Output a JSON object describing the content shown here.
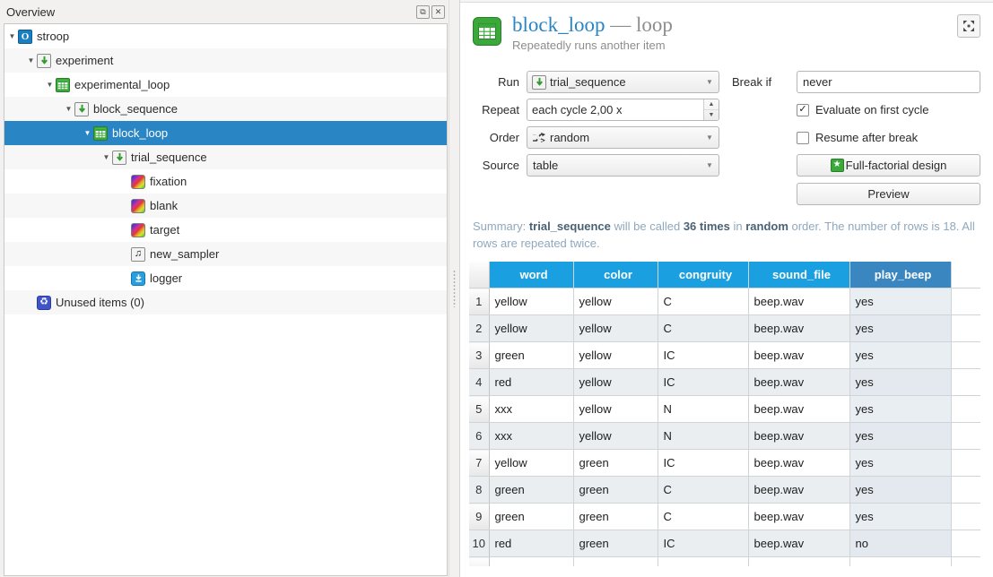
{
  "overview": {
    "title": "Overview",
    "dock_buttons": [
      {
        "name": "undock-button",
        "glyph": "⧉"
      },
      {
        "name": "close-button",
        "glyph": "✕"
      }
    ],
    "tree": [
      {
        "label": "stroop",
        "icon": "experiment-icon",
        "depth": 0,
        "expanded": true,
        "selected": false
      },
      {
        "label": "experiment",
        "icon": "sequence-icon",
        "depth": 1,
        "expanded": true,
        "selected": false
      },
      {
        "label": "experimental_loop",
        "icon": "loop-icon",
        "depth": 2,
        "expanded": true,
        "selected": false
      },
      {
        "label": "block_sequence",
        "icon": "sequence-icon",
        "depth": 3,
        "expanded": true,
        "selected": false
      },
      {
        "label": "block_loop",
        "icon": "loop-icon",
        "depth": 4,
        "expanded": true,
        "selected": true
      },
      {
        "label": "trial_sequence",
        "icon": "sequence-icon",
        "depth": 5,
        "expanded": true,
        "selected": false
      },
      {
        "label": "fixation",
        "icon": "sketchpad-icon",
        "depth": 6,
        "expanded": null,
        "selected": false
      },
      {
        "label": "blank",
        "icon": "sketchpad-icon",
        "depth": 6,
        "expanded": null,
        "selected": false
      },
      {
        "label": "target",
        "icon": "sketchpad-icon",
        "depth": 6,
        "expanded": null,
        "selected": false
      },
      {
        "label": "new_sampler",
        "icon": "sampler-icon",
        "depth": 6,
        "expanded": null,
        "selected": false
      },
      {
        "label": "logger",
        "icon": "logger-icon",
        "depth": 6,
        "expanded": null,
        "selected": false
      },
      {
        "label": "Unused items (0)",
        "icon": "unused-icon",
        "depth": 1,
        "expanded": null,
        "selected": false
      }
    ]
  },
  "editor": {
    "title_name": "block_loop",
    "title_dash": "—",
    "title_kind": "loop",
    "subtitle": "Repeatedly runs another item",
    "maximize_tooltip": "Maximize",
    "labels": {
      "run": "Run",
      "repeat": "Repeat",
      "order": "Order",
      "source": "Source",
      "break_if": "Break if"
    },
    "values": {
      "run": "trial_sequence",
      "repeat": "each cycle 2,00 x",
      "order": "random",
      "source": "table",
      "break_if": "never"
    },
    "checkboxes": [
      {
        "label": "Evaluate on first cycle",
        "checked": true,
        "mark": "✓"
      },
      {
        "label": "Resume after break",
        "checked": false,
        "mark": ""
      }
    ],
    "buttons": {
      "full_factorial": "Full-factorial design",
      "preview": "Preview"
    },
    "summary": {
      "prefix": "Summary: ",
      "item": "trial_sequence",
      "mid1": " will be called ",
      "times": "36 times",
      "mid2": " in ",
      "order": "random",
      "tail": " order. The number of rows is 18. All rows are repeated twice."
    },
    "colors": {
      "accent": "#2a85c4",
      "header_blue": "#1a9fe0",
      "selected_header_blue": "#3a86c0",
      "loop_green": "#3aa93a",
      "summary_text": "#8fa8bd"
    }
  },
  "table": {
    "columns": [
      "word",
      "color",
      "congruity",
      "sound_file",
      "play_beep"
    ],
    "selected_column": "play_beep",
    "rows": [
      {
        "n": "1",
        "word": "yellow",
        "color": "yellow",
        "congruity": "C",
        "sound_file": "beep.wav",
        "play_beep": "yes"
      },
      {
        "n": "2",
        "word": "yellow",
        "color": "yellow",
        "congruity": "C",
        "sound_file": "beep.wav",
        "play_beep": "yes"
      },
      {
        "n": "3",
        "word": "green",
        "color": "yellow",
        "congruity": "IC",
        "sound_file": "beep.wav",
        "play_beep": "yes"
      },
      {
        "n": "4",
        "word": "red",
        "color": "yellow",
        "congruity": "IC",
        "sound_file": "beep.wav",
        "play_beep": "yes"
      },
      {
        "n": "5",
        "word": "xxx",
        "color": "yellow",
        "congruity": "N",
        "sound_file": "beep.wav",
        "play_beep": "yes"
      },
      {
        "n": "6",
        "word": "xxx",
        "color": "yellow",
        "congruity": "N",
        "sound_file": "beep.wav",
        "play_beep": "yes"
      },
      {
        "n": "7",
        "word": "yellow",
        "color": "green",
        "congruity": "IC",
        "sound_file": "beep.wav",
        "play_beep": "yes"
      },
      {
        "n": "8",
        "word": "green",
        "color": "green",
        "congruity": "C",
        "sound_file": "beep.wav",
        "play_beep": "yes"
      },
      {
        "n": "9",
        "word": "green",
        "color": "green",
        "congruity": "C",
        "sound_file": "beep.wav",
        "play_beep": "yes"
      },
      {
        "n": "10",
        "word": "red",
        "color": "green",
        "congruity": "IC",
        "sound_file": "beep.wav",
        "play_beep": "no"
      }
    ]
  }
}
